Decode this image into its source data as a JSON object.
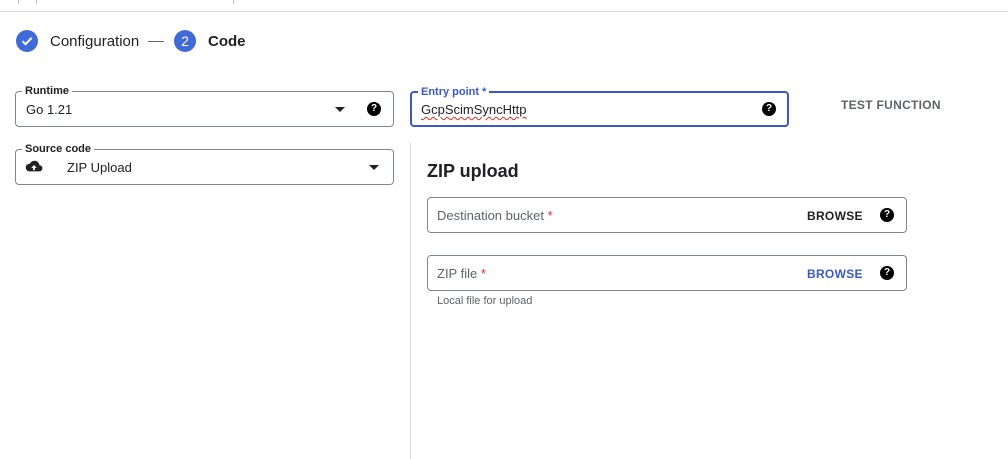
{
  "stepper": {
    "step1_label": "Configuration",
    "step2_number": "2",
    "step2_label": "Code"
  },
  "runtime": {
    "label": "Runtime",
    "value": "Go 1.21",
    "help": "?"
  },
  "entry_point": {
    "label": "Entry point *",
    "value": "GcpScimSyncHttp",
    "help": "?"
  },
  "test_function_label": "TEST FUNCTION",
  "source_code": {
    "label": "Source code",
    "value": "ZIP Upload"
  },
  "zip_upload": {
    "title": "ZIP upload",
    "destination_bucket": {
      "placeholder": "Destination bucket",
      "required_mark": "*",
      "browse_label": "BROWSE",
      "browse_color": "#202124",
      "help": "?"
    },
    "zip_file": {
      "placeholder": "ZIP file",
      "required_mark": "*",
      "browse_label": "BROWSE",
      "browse_color": "#3b58c8",
      "help": "?",
      "hint": "Local file for upload"
    }
  },
  "colors": {
    "accent": "#3f6ad8",
    "focus_border": "#3b58c8",
    "required": "#d93025"
  }
}
